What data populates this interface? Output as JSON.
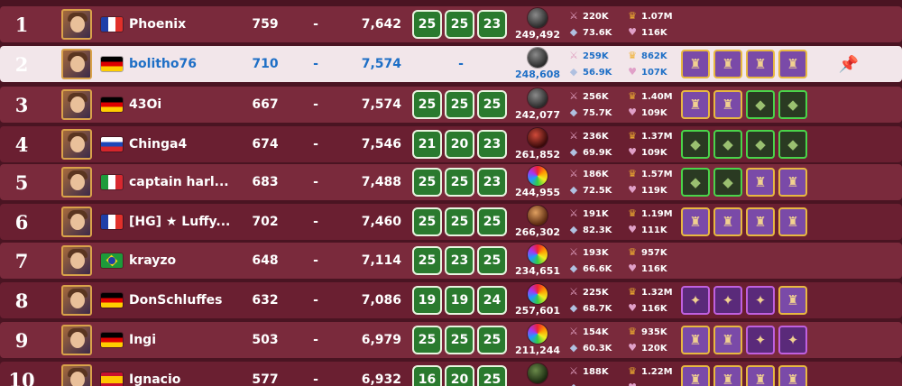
{
  "leaderboard": {
    "rows": [
      {
        "rank": "1",
        "name": "Phoenix",
        "flag": "fr",
        "level": "759",
        "dash": "-",
        "power": "7,642",
        "badges": [
          "25",
          "25",
          "23"
        ],
        "orb": "dark",
        "score": "249,492",
        "s1": "220K",
        "s2": "73.6K",
        "s3": "1.07M",
        "s4": "116K",
        "items": []
      },
      {
        "rank": "2",
        "name": "bolitho76",
        "flag": "de",
        "level": "710",
        "dash": "-",
        "power": "7,574",
        "badges": [],
        "nobadge": "-",
        "orb": "dark",
        "score": "248,608",
        "s1": "259K",
        "s2": "56.9K",
        "s3": "862K",
        "s4": "107K",
        "items": [
          "leg",
          "leg",
          "leg",
          "leg"
        ],
        "pin": true,
        "highlight": true
      },
      {
        "rank": "3",
        "name": "43Oi",
        "flag": "de",
        "level": "667",
        "dash": "-",
        "power": "7,574",
        "badges": [
          "25",
          "25",
          "25"
        ],
        "orb": "dark",
        "score": "242,077",
        "s1": "256K",
        "s2": "75.7K",
        "s3": "1.40M",
        "s4": "109K",
        "items": [
          "leg",
          "leg",
          "rare",
          "rare"
        ]
      },
      {
        "rank": "4",
        "name": "Chinga4",
        "flag": "ru",
        "level": "674",
        "dash": "-",
        "power": "7,546",
        "badges": [
          "21",
          "20",
          "23"
        ],
        "orb": "red",
        "score": "261,852",
        "s1": "236K",
        "s2": "69.9K",
        "s3": "1.37M",
        "s4": "109K",
        "items": [
          "rare",
          "rare",
          "rare",
          "rare"
        ]
      },
      {
        "rank": "5",
        "name": "captain harl...",
        "flag": "it",
        "level": "683",
        "dash": "-",
        "power": "7,488",
        "badges": [
          "25",
          "25",
          "23"
        ],
        "orb": "rainbow",
        "score": "244,955",
        "s1": "186K",
        "s2": "72.5K",
        "s3": "1.57M",
        "s4": "119K",
        "items": [
          "rare",
          "rare",
          "leg",
          "leg"
        ]
      },
      {
        "rank": "6",
        "name": "[HG] ★ Luffy...",
        "flag": "fr",
        "level": "702",
        "dash": "-",
        "power": "7,460",
        "badges": [
          "25",
          "25",
          "25"
        ],
        "orb": "orange",
        "score": "266,302",
        "s1": "191K",
        "s2": "82.3K",
        "s3": "1.19M",
        "s4": "111K",
        "items": [
          "leg",
          "leg",
          "leg",
          "leg"
        ]
      },
      {
        "rank": "7",
        "name": "krayzo",
        "flag": "br",
        "level": "648",
        "dash": "-",
        "power": "7,114",
        "badges": [
          "25",
          "23",
          "25"
        ],
        "orb": "rainbow",
        "score": "234,651",
        "s1": "193K",
        "s2": "66.6K",
        "s3": "957K",
        "s4": "116K",
        "items": []
      },
      {
        "rank": "8",
        "name": "DonSchluffes",
        "flag": "de",
        "level": "632",
        "dash": "-",
        "power": "7,086",
        "badges": [
          "19",
          "19",
          "24"
        ],
        "orb": "rainbow",
        "score": "257,601",
        "s1": "225K",
        "s2": "68.7K",
        "s3": "1.32M",
        "s4": "116K",
        "items": [
          "epic",
          "epic",
          "epic",
          "leg"
        ]
      },
      {
        "rank": "9",
        "name": "Ingi",
        "flag": "de",
        "level": "503",
        "dash": "-",
        "power": "6,979",
        "badges": [
          "25",
          "25",
          "25"
        ],
        "orb": "rainbow",
        "score": "211,244",
        "s1": "154K",
        "s2": "60.3K",
        "s3": "935K",
        "s4": "120K",
        "items": [
          "leg",
          "leg",
          "epic",
          "epic"
        ]
      },
      {
        "rank": "10",
        "name": "Ignacio",
        "flag": "es",
        "level": "577",
        "dash": "-",
        "power": "6,932",
        "badges": [
          "16",
          "20",
          "25"
        ],
        "orb": "green",
        "score": "",
        "s1": "188K",
        "s2": "",
        "s3": "1.22M",
        "s4": "",
        "items": [
          "leg",
          "leg",
          "leg",
          "leg"
        ]
      }
    ]
  },
  "colors": {
    "rowA": "#7a2a3c",
    "rowB": "#6a1f31",
    "highlight": "#f2e6ea",
    "badge": "#2a7a2e",
    "accentBlue": "#1e6fc6"
  },
  "icons": {
    "orb": "orb-icon",
    "s1": "claw-icon",
    "s2": "diamond-icon",
    "s3": "crown-icon",
    "s4": "heart-question-icon",
    "pin": "push-pin-icon"
  }
}
